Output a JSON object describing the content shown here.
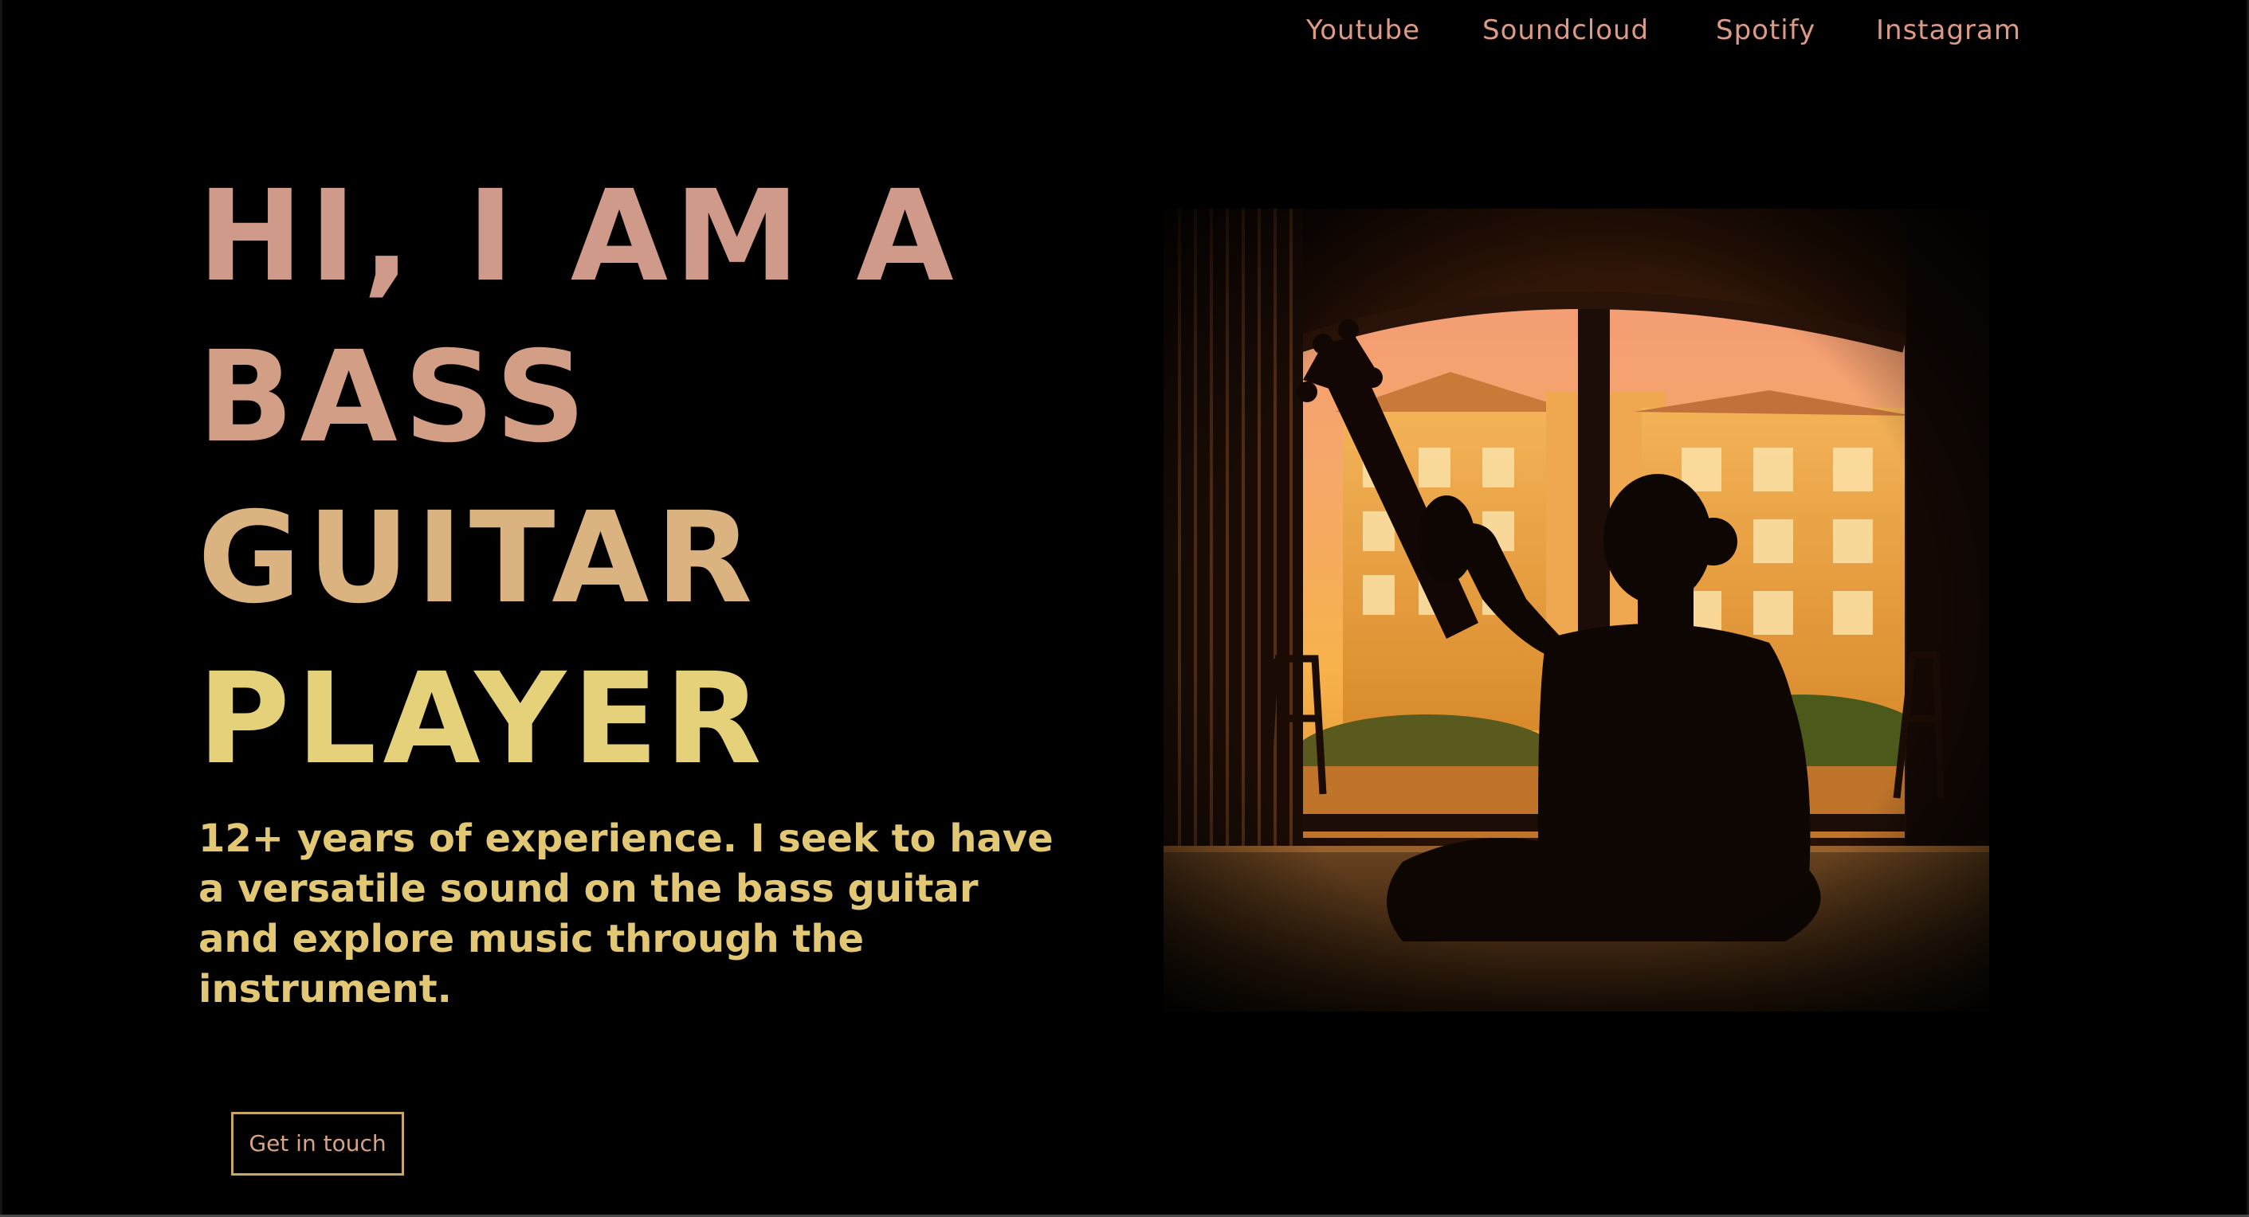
{
  "nav": {
    "links": [
      {
        "label": "Youtube"
      },
      {
        "label": "Soundcloud"
      },
      {
        "label": "Spotify"
      },
      {
        "label": "Instagram"
      }
    ]
  },
  "hero": {
    "headline_lines": [
      "HI, I AM A",
      "BASS",
      "GUITAR",
      "PLAYER"
    ],
    "description": "12+ years of experience. I seek to have a versatile sound on the bass guitar and explore music through the instrument.",
    "cta_label": "Get in touch",
    "image_icon": "bass-player-silhouette-photo"
  },
  "colors": {
    "background": "#000000",
    "nav_link": "#dc9a87",
    "headline_top": "#d09a8a",
    "headline_bottom": "#e6d17b",
    "description": "#e2c874",
    "cta_border": "#c8a764"
  }
}
